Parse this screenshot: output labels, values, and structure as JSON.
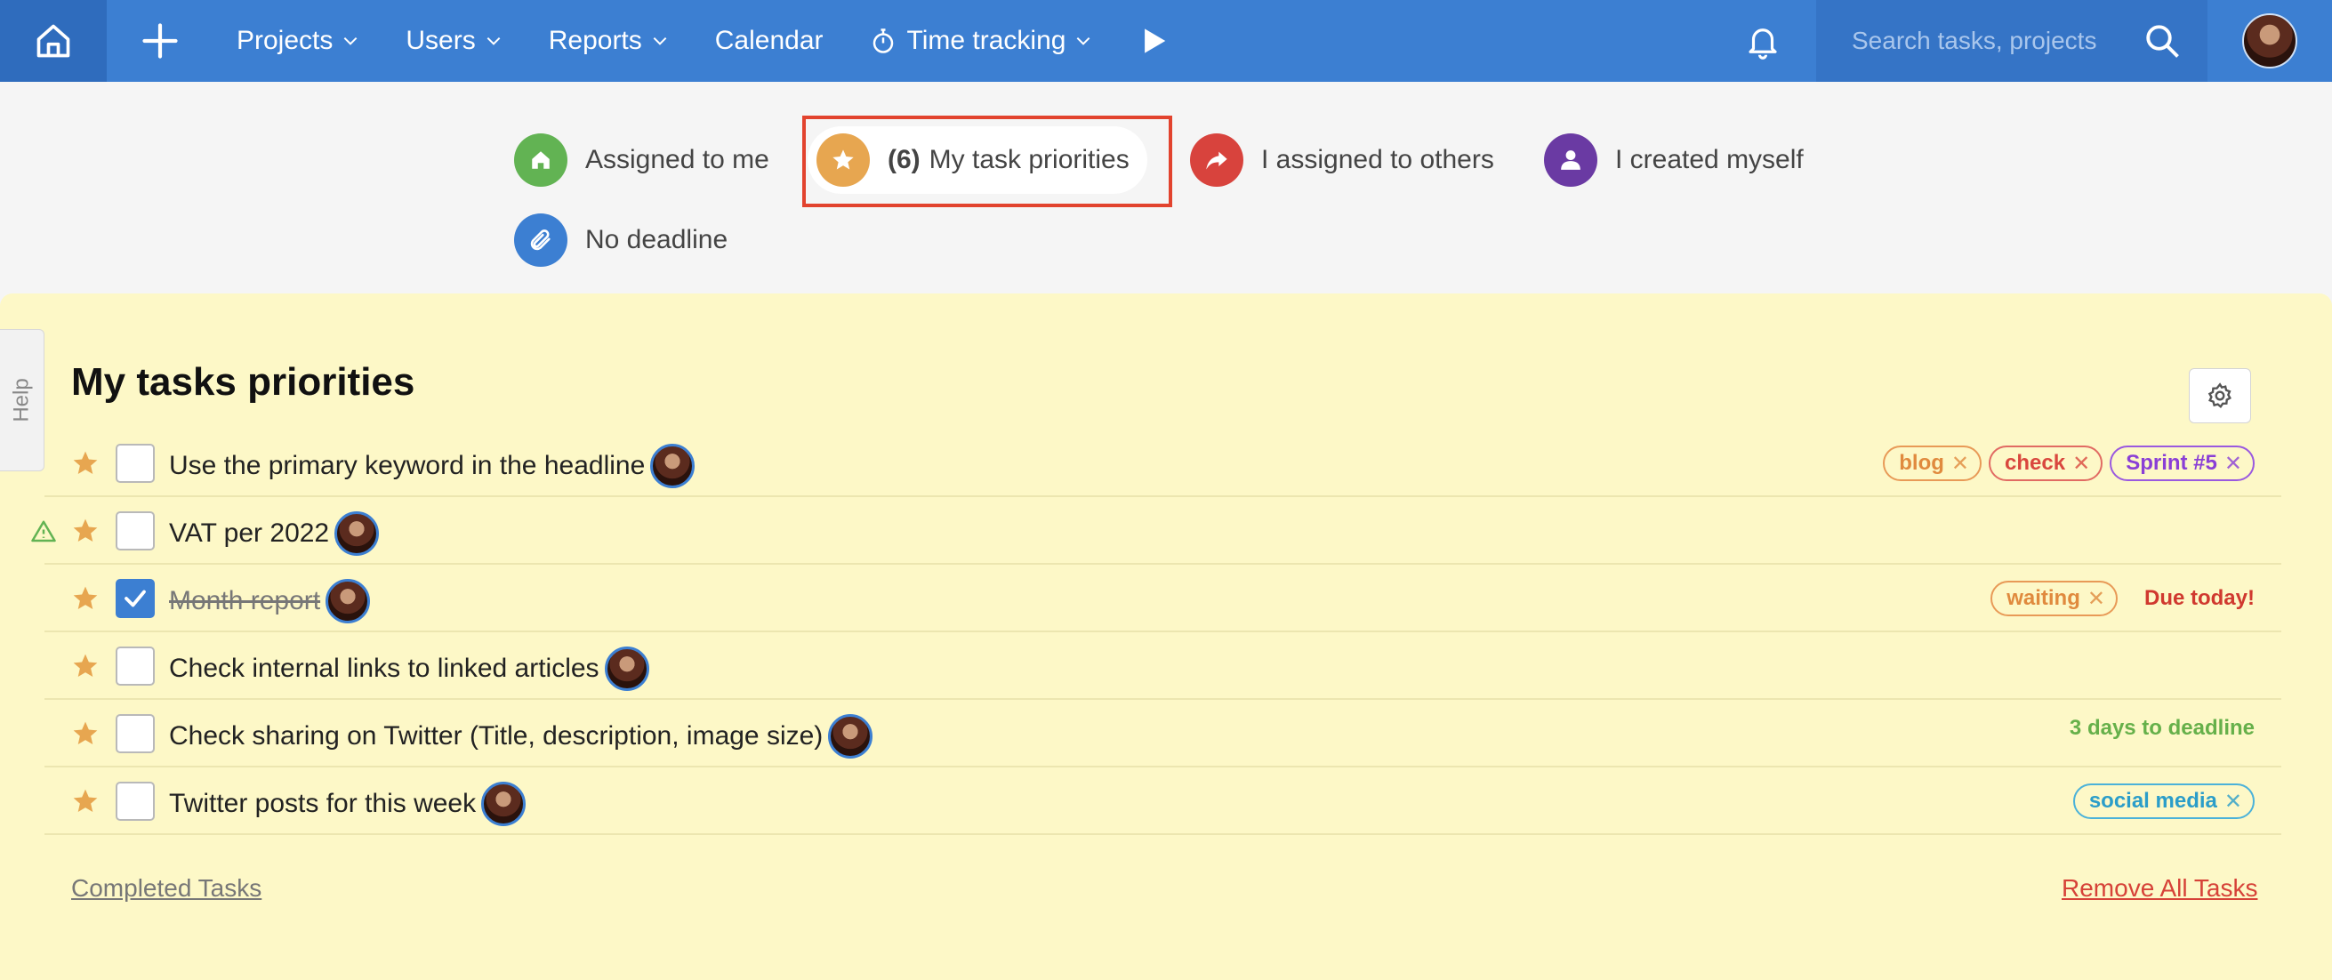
{
  "nav": {
    "projects": "Projects",
    "users": "Users",
    "reports": "Reports",
    "calendar": "Calendar",
    "time_tracking": "Time tracking",
    "search_placeholder": "Search tasks, projects"
  },
  "filters": {
    "assigned_to_me": "Assigned to me",
    "priorities_count": "(6)",
    "priorities_label": "My task priorities",
    "assigned_to_others": "I assigned to others",
    "created_myself": "I created myself",
    "no_deadline": "No deadline"
  },
  "colors": {
    "nav_blue": "#3c7fd2",
    "green": "#62b353",
    "orange": "#e7a650",
    "red": "#d8433d",
    "purple": "#6a3aa3",
    "blue": "#3c7fd2",
    "highlight": "#e2432e"
  },
  "panel": {
    "help": "Help",
    "title": "My tasks priorities",
    "completed_link": "Completed Tasks",
    "remove_link": "Remove All Tasks"
  },
  "tasks": [
    {
      "title": "Use the primary keyword in the headline",
      "tags": [
        "blog",
        "check",
        "Sprint #5"
      ]
    },
    {
      "title": "VAT per 2022"
    },
    {
      "title": "Month report",
      "completed": true,
      "tags": [
        "waiting"
      ],
      "status": "Due today!"
    },
    {
      "title": "Check internal links to linked articles"
    },
    {
      "title": "Check sharing on Twitter (Title, description, image size)",
      "status": "3 days to deadline"
    },
    {
      "title": "Twitter posts for this week",
      "tags": [
        "social media"
      ]
    }
  ]
}
